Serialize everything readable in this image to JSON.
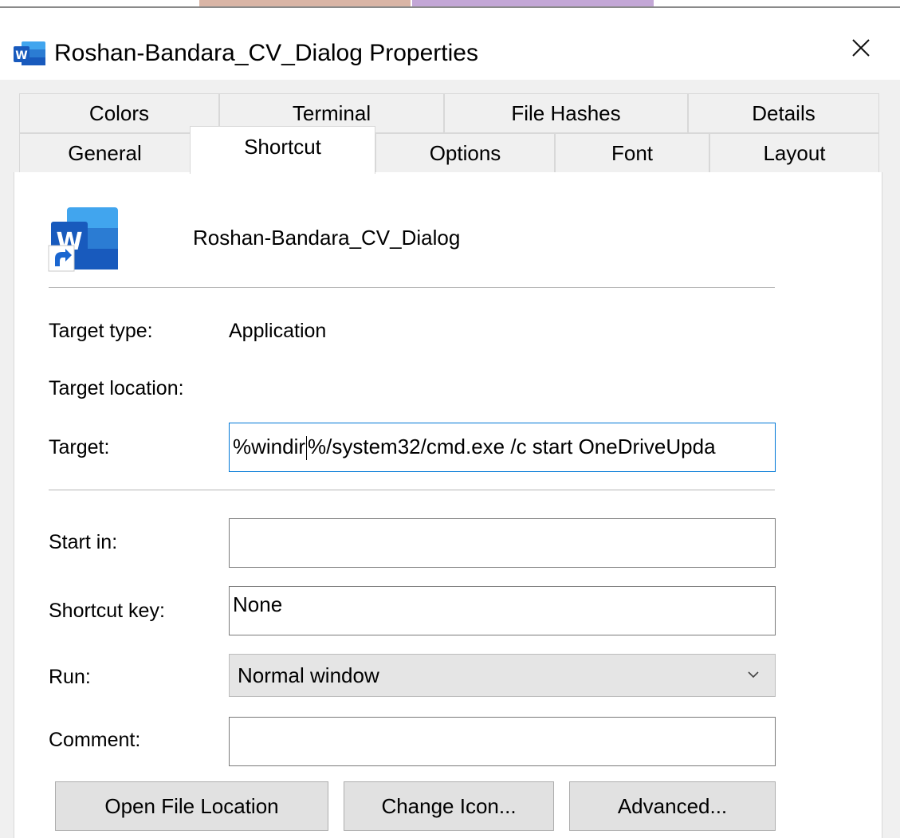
{
  "window": {
    "title": "Roshan-Bandara_CV_Dialog Properties",
    "close_glyph": "✕"
  },
  "tabs": {
    "row1": [
      "Colors",
      "Terminal",
      "File Hashes",
      "Details"
    ],
    "row2": [
      "General",
      "Shortcut",
      "Options",
      "Font",
      "Layout"
    ],
    "active": "Shortcut"
  },
  "shortcut": {
    "file_name": "Roshan-Bandara_CV_Dialog",
    "target_type_label": "Target type:",
    "target_type_value": "Application",
    "target_location_label": "Target location:",
    "target_label": "Target:",
    "target_value_before_cursor": "%windir",
    "target_value_after_cursor": "%/system32/cmd.exe /c start OneDriveUpda",
    "start_in_label": "Start in:",
    "start_in_value": "",
    "shortcut_key_label": "Shortcut key:",
    "shortcut_key_value": "None",
    "run_label": "Run:",
    "run_value": "Normal window",
    "comment_label": "Comment:",
    "comment_value": ""
  },
  "buttons": {
    "open_file_location": "Open File Location",
    "change_icon": "Change Icon...",
    "advanced": "Advanced..."
  },
  "icons": {
    "app": "word-shortcut-icon",
    "title": "word-icon",
    "close": "close-icon",
    "dropdown": "chevron-down-icon"
  },
  "colors": {
    "word_blue": "#185abd",
    "focus_blue": "#0078d7",
    "dialog_bg": "#f0f0f0",
    "panel_bg": "#ffffff"
  }
}
